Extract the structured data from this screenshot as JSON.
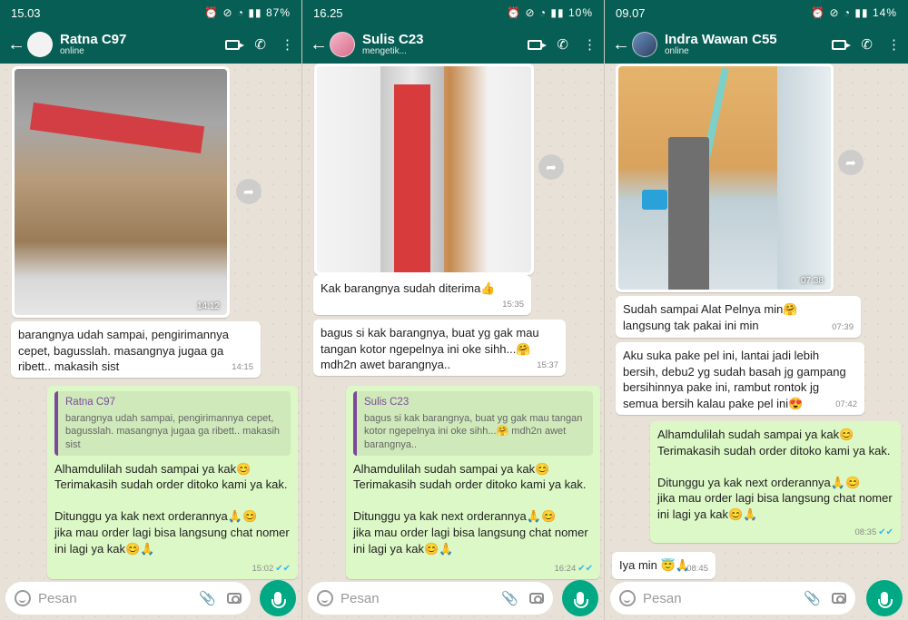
{
  "panels": [
    {
      "status": {
        "time": "15.03",
        "battery": "87%"
      },
      "contact": {
        "name": "Ratna C97",
        "status": "online"
      },
      "image_time": "14:12",
      "incoming": {
        "text": "barangnya udah sampai, pengirimannya cepet, bagusslah. masangnya jugaa ga ribett.. makasih sist",
        "time": "14:15"
      },
      "reply": {
        "quote_name": "Ratna C97",
        "quote_text": "barangnya udah sampai, pengirimannya cepet, bagusslah. masangnya jugaa ga ribett.. makasih sist",
        "text": "Alhamdulilah sudah sampai ya kak😊\nTerimakasih sudah order ditoko kami ya kak.\n\nDitunggu ya kak next orderannya🙏😊\njika mau order lagi bisa langsung chat nomer ini lagi ya kak😊🙏",
        "time": "15:02"
      },
      "input_placeholder": "Pesan"
    },
    {
      "status": {
        "time": "16.25",
        "battery": "10%"
      },
      "contact": {
        "name": "Sulis C23",
        "status": "mengetik..."
      },
      "incoming1": {
        "text": "Kak barangnya sudah diterima👍",
        "time": "15:35"
      },
      "incoming2": {
        "text": "bagus si kak barangnya, buat yg gak mau tangan kotor ngepelnya ini oke sihh...🤗 mdh2n awet barangnya..",
        "time": "15:37"
      },
      "reply": {
        "quote_name": "Sulis C23",
        "quote_text": "bagus si kak barangnya, buat yg gak mau tangan kotor ngepelnya ini oke sihh...🤗 mdh2n awet barangnya..",
        "text": "Alhamdulilah sudah sampai ya kak😊\nTerimakasih sudah order ditoko kami ya kak.\n\nDitunggu ya kak next orderannya🙏😊\njika mau order lagi bisa langsung chat nomer ini lagi ya kak😊🙏",
        "time": "16:24"
      },
      "input_placeholder": "Pesan"
    },
    {
      "status": {
        "time": "09.07",
        "battery": "14%"
      },
      "contact": {
        "name": "Indra Wawan C55",
        "status": "online"
      },
      "image_time": "07:38",
      "incoming1": {
        "text": "Sudah sampai Alat Pelnya min🤗\nlangsung tak pakai ini min",
        "time": "07:39"
      },
      "incoming2": {
        "text": "Aku suka pake pel ini, lantai jadi lebih bersih, debu2 yg sudah basah jg gampang bersihinnya pake ini, rambut rontok jg semua bersih kalau pake pel ini😍",
        "time": "07:42"
      },
      "reply": {
        "text": "Alhamdulilah sudah sampai ya kak😊\nTerimakasih sudah order ditoko kami ya kak.\n\nDitunggu ya kak next orderannya🙏😊\njika mau order lagi bisa langsung chat nomer ini lagi ya kak😊🙏",
        "time": "08:35"
      },
      "incoming3": {
        "text": "Iya min 😇🙏",
        "time": "08:45"
      },
      "input_placeholder": "Pesan"
    }
  ],
  "colors": {
    "header": "#075e54",
    "outgoing": "#dcf8c6",
    "incoming": "#ffffff",
    "chat_bg": "#e8e1d8",
    "mic_button": "#00a884"
  }
}
